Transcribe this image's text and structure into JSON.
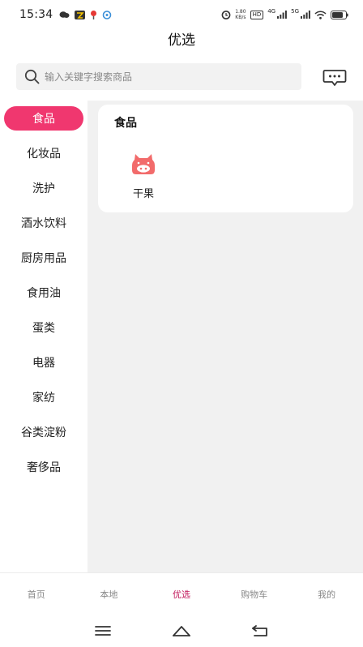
{
  "status_bar": {
    "time": "15:34",
    "net_speed_value": "1.80",
    "net_speed_unit": "KB/s",
    "hd_label": "HD",
    "sig1_label": "4G",
    "sig2_label": "5G"
  },
  "header": {
    "title": "优选"
  },
  "search": {
    "placeholder": "输入关键字搜索商品"
  },
  "sidebar": {
    "items": [
      {
        "label": "食品",
        "active": true
      },
      {
        "label": "化妆品"
      },
      {
        "label": "洗护"
      },
      {
        "label": "酒水饮料"
      },
      {
        "label": "厨房用品"
      },
      {
        "label": "食用油"
      },
      {
        "label": "蛋类"
      },
      {
        "label": "电器"
      },
      {
        "label": "家纺"
      },
      {
        "label": "谷类淀粉"
      },
      {
        "label": "奢侈品"
      }
    ]
  },
  "main": {
    "section_title": "食品",
    "categories": [
      {
        "label": "干果",
        "icon": "pig-icon"
      }
    ]
  },
  "tabbar": {
    "tabs": [
      {
        "label": "首页"
      },
      {
        "label": "本地"
      },
      {
        "label": "优选",
        "active": true
      },
      {
        "label": "购物车"
      },
      {
        "label": "我的"
      }
    ]
  },
  "colors": {
    "accent": "#f0376f",
    "active_tab": "#c2185b",
    "background_panel": "#f1f1f1"
  }
}
